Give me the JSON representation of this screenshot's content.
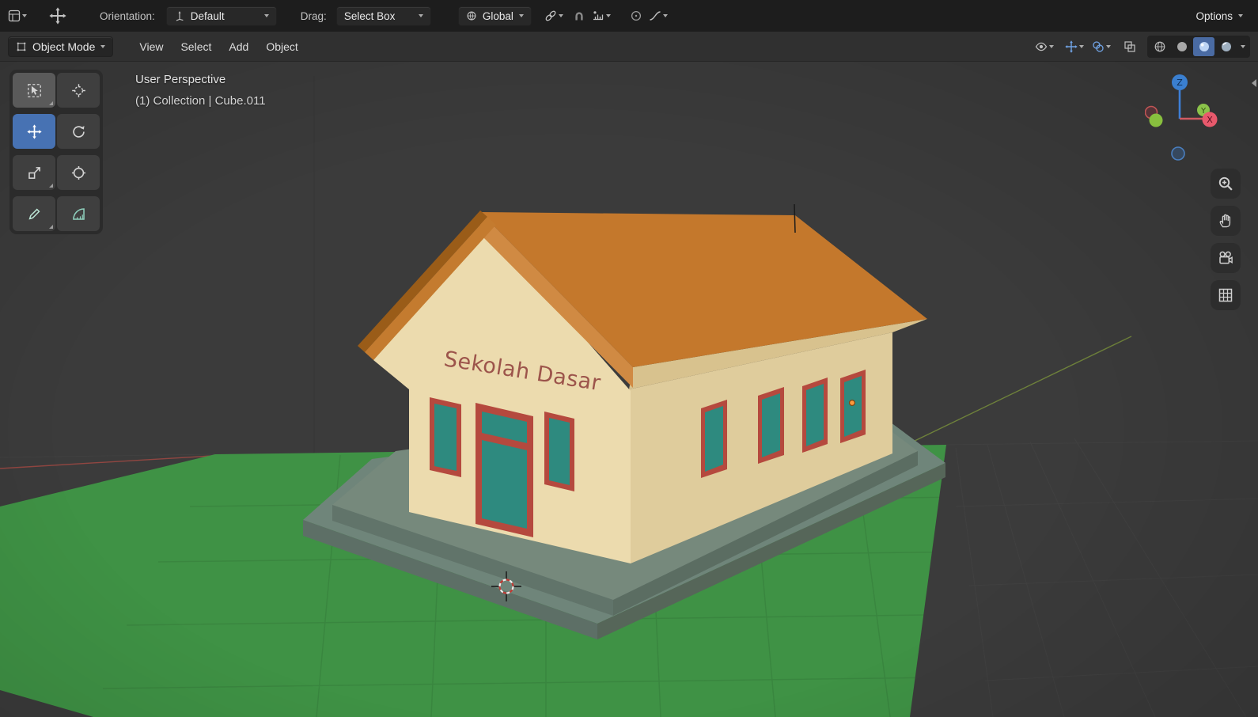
{
  "header": {
    "orientation_label": "Orientation:",
    "orientation_value": "Default",
    "drag_label": "Drag:",
    "drag_value": "Select Box",
    "pivot_value": "Global",
    "options_label": "Options"
  },
  "viewport_header": {
    "mode_value": "Object Mode",
    "menus": [
      {
        "label": "View"
      },
      {
        "label": "Select"
      },
      {
        "label": "Add"
      },
      {
        "label": "Object"
      }
    ]
  },
  "overlay": {
    "view_label": "User Perspective",
    "breadcrumb": "(1) Collection | Cube.011"
  },
  "gizmo": {
    "z_label": "Z",
    "x_label": "X",
    "y_label": "Y"
  },
  "scene": {
    "sign_text": "Sekolah Dasar",
    "colors": {
      "background": "#3b3b3b",
      "ground_green": "#3f9245",
      "roof_top": "#c4782c",
      "roof_fascia": "#d08a43",
      "roof_left_dark": "#9a5c18",
      "roof_left_fascia": "#c47b2f",
      "wall_front": "#ecdbae",
      "wall_side": "#dfcc9c",
      "eave_shadow": "#d8c28e",
      "window_teal": "#2e8a7f",
      "frame_red": "#b5493e",
      "sign_red": "#9c544b",
      "step_top": "#76897c",
      "step_front": "#61746a",
      "step_side": "#5b6d62",
      "base_top": "#6f857a",
      "base_front": "#5d6f66",
      "base_side": "#566659",
      "accent_blue": "#4772b3"
    }
  },
  "icons": {
    "tools": [
      "select-box",
      "cursor-3d",
      "move",
      "rotate",
      "scale",
      "transform",
      "annotate",
      "measure"
    ],
    "nav": [
      "zoom",
      "pan",
      "camera-view",
      "toggle-ortho"
    ],
    "snap": [
      "proportional-link",
      "snap-magnet",
      "snap-increment"
    ],
    "shading": [
      "wireframe",
      "solid",
      "material-preview",
      "rendered"
    ]
  }
}
